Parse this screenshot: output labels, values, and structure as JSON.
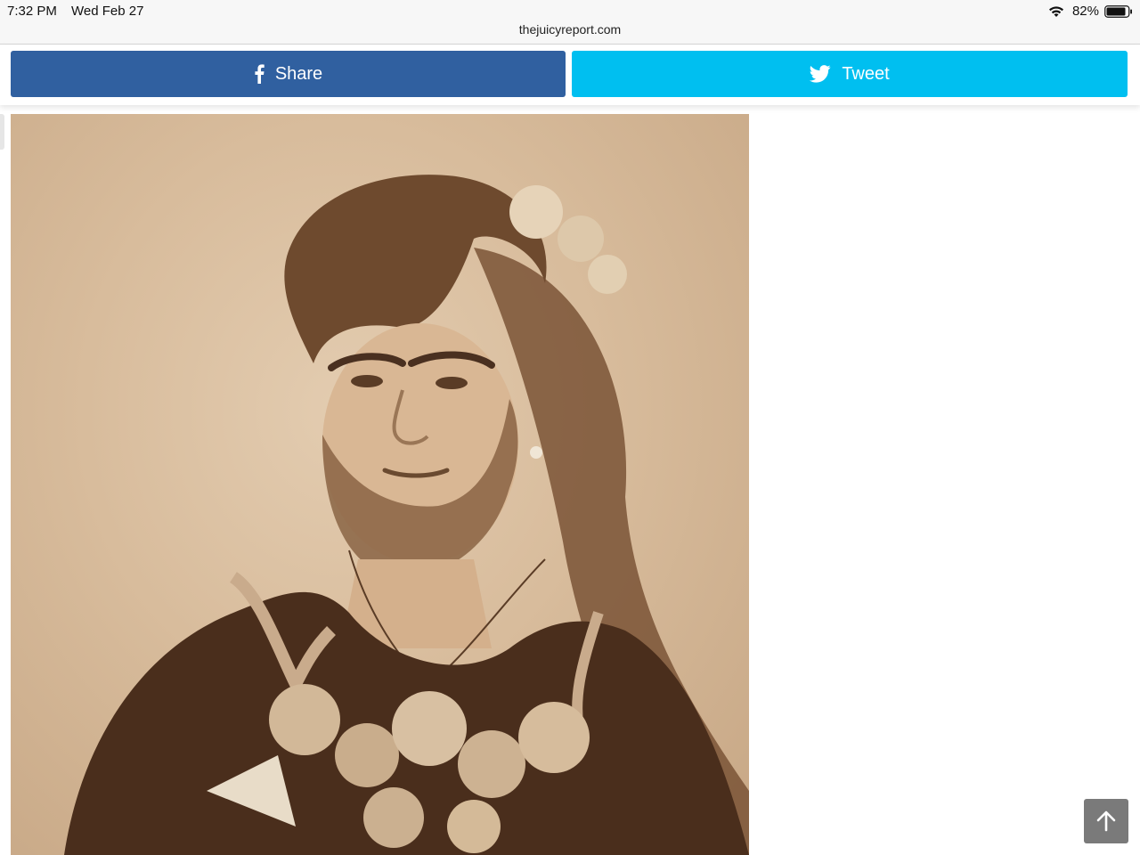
{
  "status_bar": {
    "time": "7:32 PM",
    "date": "Wed Feb 27",
    "battery": "82%",
    "icons": [
      "wifi-icon",
      "battery-icon"
    ]
  },
  "browser": {
    "url": "thejuicyreport.com"
  },
  "share_bar": {
    "facebook_label": "Share",
    "twitter_label": "Tweet",
    "facebook_color": "#3060a0",
    "twitter_color": "#00bff0",
    "icons": [
      "facebook-icon",
      "twitter-icon"
    ]
  },
  "article": {
    "image_tone": "sepia"
  },
  "scroll_top": {
    "icon": "arrow-up-icon"
  }
}
